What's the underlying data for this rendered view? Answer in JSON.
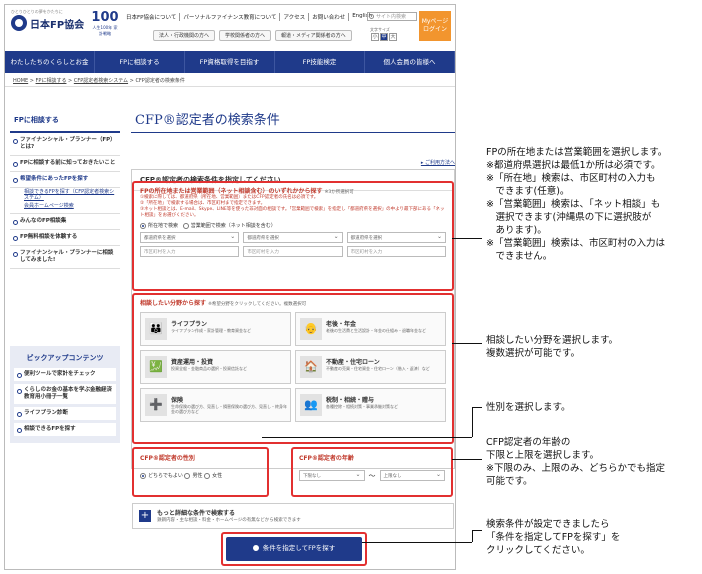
{
  "header": {
    "tagline": "ひとりひとりの夢をかたちに",
    "logo": "日本FP協会",
    "logo2_big": "100",
    "logo2_small": "人生100年 家計戦略",
    "links": [
      "日本FP協会について",
      "パーソナルファイナンス教育について",
      "アクセス",
      "お問い合わせ",
      "English"
    ],
    "search_placeholder": "サイト内検索",
    "subbuttons": [
      "法人・行政機関の方へ",
      "学校関係者の方へ",
      "報道・メディア関係者の方へ"
    ],
    "font_size_label": "文字サイズ",
    "font_sizes": [
      "小",
      "中",
      "大"
    ],
    "mypage": [
      "Myページ",
      "ログイン"
    ]
  },
  "nav": [
    "わたしたちのくらしとお金",
    "FPに相談する",
    "FP資格取得を目指す",
    "FP技能検定",
    "個人会員の皆様へ"
  ],
  "breadcrumb": [
    "HOME",
    "FPに相談する",
    "CFP認定者検索システム",
    "CFP認定者の検索条件"
  ],
  "sidebar": {
    "title": "FPに相談する",
    "items": [
      {
        "label": "ファイナンシャル・プランナー（FP）とは?"
      },
      {
        "label": "FPに相談する前に知っておきたいこと"
      },
      {
        "label": "希望条件にあったFPを探す"
      }
    ],
    "subitems": [
      "相談できるFPを探す（CFP認定者検索システム）",
      "会員ホームページ検索"
    ],
    "items2": [
      {
        "label": "みんなのFP相談集"
      },
      {
        "label": "FP無料相談を体験する"
      },
      {
        "label": "ファイナンシャル・プランナーに相談してみました!"
      }
    ]
  },
  "pickup": {
    "title": "ピックアップコンテンツ",
    "items": [
      "便利ツールで家計をチェック",
      "くらしのお金の基本を学ぶ金融経済教育用小冊子一覧",
      "ライフプラン診断",
      "相談できるFPを探す"
    ]
  },
  "main": {
    "title": "CFP®認定者の検索条件",
    "help": "ご利用方法へ",
    "panel_title": "CFP®認定者の検索条件を指定してください"
  },
  "location": {
    "title": "FPの所在地または営業範囲（ネット相談含む）のいずれかから探す",
    "note": "※3か所選択可",
    "notes": [
      "①検索に際しては、都道府県（所在地、営業範囲）またはCFP認定者の氏名は必須です。",
      "②「所在地」で検索する場合は、市区町村まで指定できます。",
      "③ネット相談とは、E-mail、Skype、LINE等を使った非対面の相談です。「営業範囲で検索」を指定し「都道府県を選択」の中より最下部にある「ネット相談」をお選びください。"
    ],
    "radio1": "所在地で検索",
    "radio2": "営業範囲で検索（ネット相談を含む）",
    "select_label": "都道府県を選択",
    "input_placeholder": "市区町村を入力"
  },
  "field": {
    "title": "相談したい分野から探す",
    "note": "※希望分野をクリックしてください。複数選択可",
    "cards": [
      {
        "title": "ライフプラン",
        "desc": "ライフプラン作成・家計管理・教育資金など",
        "icon": "👪"
      },
      {
        "title": "老後・年金",
        "desc": "老後の生活費と生活設計・年金の仕組み・退職年金など",
        "icon": "👴"
      },
      {
        "title": "資産運用・投資",
        "desc": "投資全般・金融商品の選択・投資信託など",
        "icon": "💹"
      },
      {
        "title": "不動産・住宅ローン",
        "desc": "不動産の売買・住宅資金・住宅ローン（借入・返済）など",
        "icon": "🏠"
      },
      {
        "title": "保険",
        "desc": "生命保険の選び方、見直し・損害保険の選び方、見直し・終身年金の選び方など",
        "icon": "➕"
      },
      {
        "title": "税制・相続・贈与",
        "desc": "各種控除・相続対策・事業承継対策など",
        "icon": "👥"
      }
    ]
  },
  "gender": {
    "title": "CFP®認定者の性別",
    "options": [
      "どちらでもよい",
      "男性",
      "女性"
    ]
  },
  "age": {
    "title": "CFP®認定者の年齢",
    "lower": "下限なし",
    "sep": "〜",
    "upper": "上限なし"
  },
  "more": {
    "title": "もっと詳細な条件で検索する",
    "desc": "鉄鋼内容・主な相談・料金・ホームページの有無などから検索できます"
  },
  "search_button": "条件を指定してFPを探す",
  "annotations": {
    "a1": [
      "FPの所在地または営業範囲を選択します。",
      "※都道府県選択は最低1か所は必須です。",
      "※「所在地」検索は、市区町村の入力も",
      "　できます(任意)。",
      "※「営業範囲」検索は、「ネット相談」も",
      "　選択できます(沖縄県の下に選択肢が",
      "　あります)。",
      "※「営業範囲」検索は、市区町村の入力は",
      "　できません。"
    ],
    "a2": [
      "相談したい分野を選択します。",
      "複数選択が可能です。"
    ],
    "a3": [
      "性別を選択します。"
    ],
    "a4": [
      "CFP認定者の年齢の",
      "下限と上限を選択します。",
      "※下限のみ、上限のみ、どちらかでも指定",
      "可能です。"
    ],
    "a5": [
      "検索条件が設定できましたら",
      "「条件を指定してFPを探す」を",
      "クリックしてください。"
    ]
  }
}
